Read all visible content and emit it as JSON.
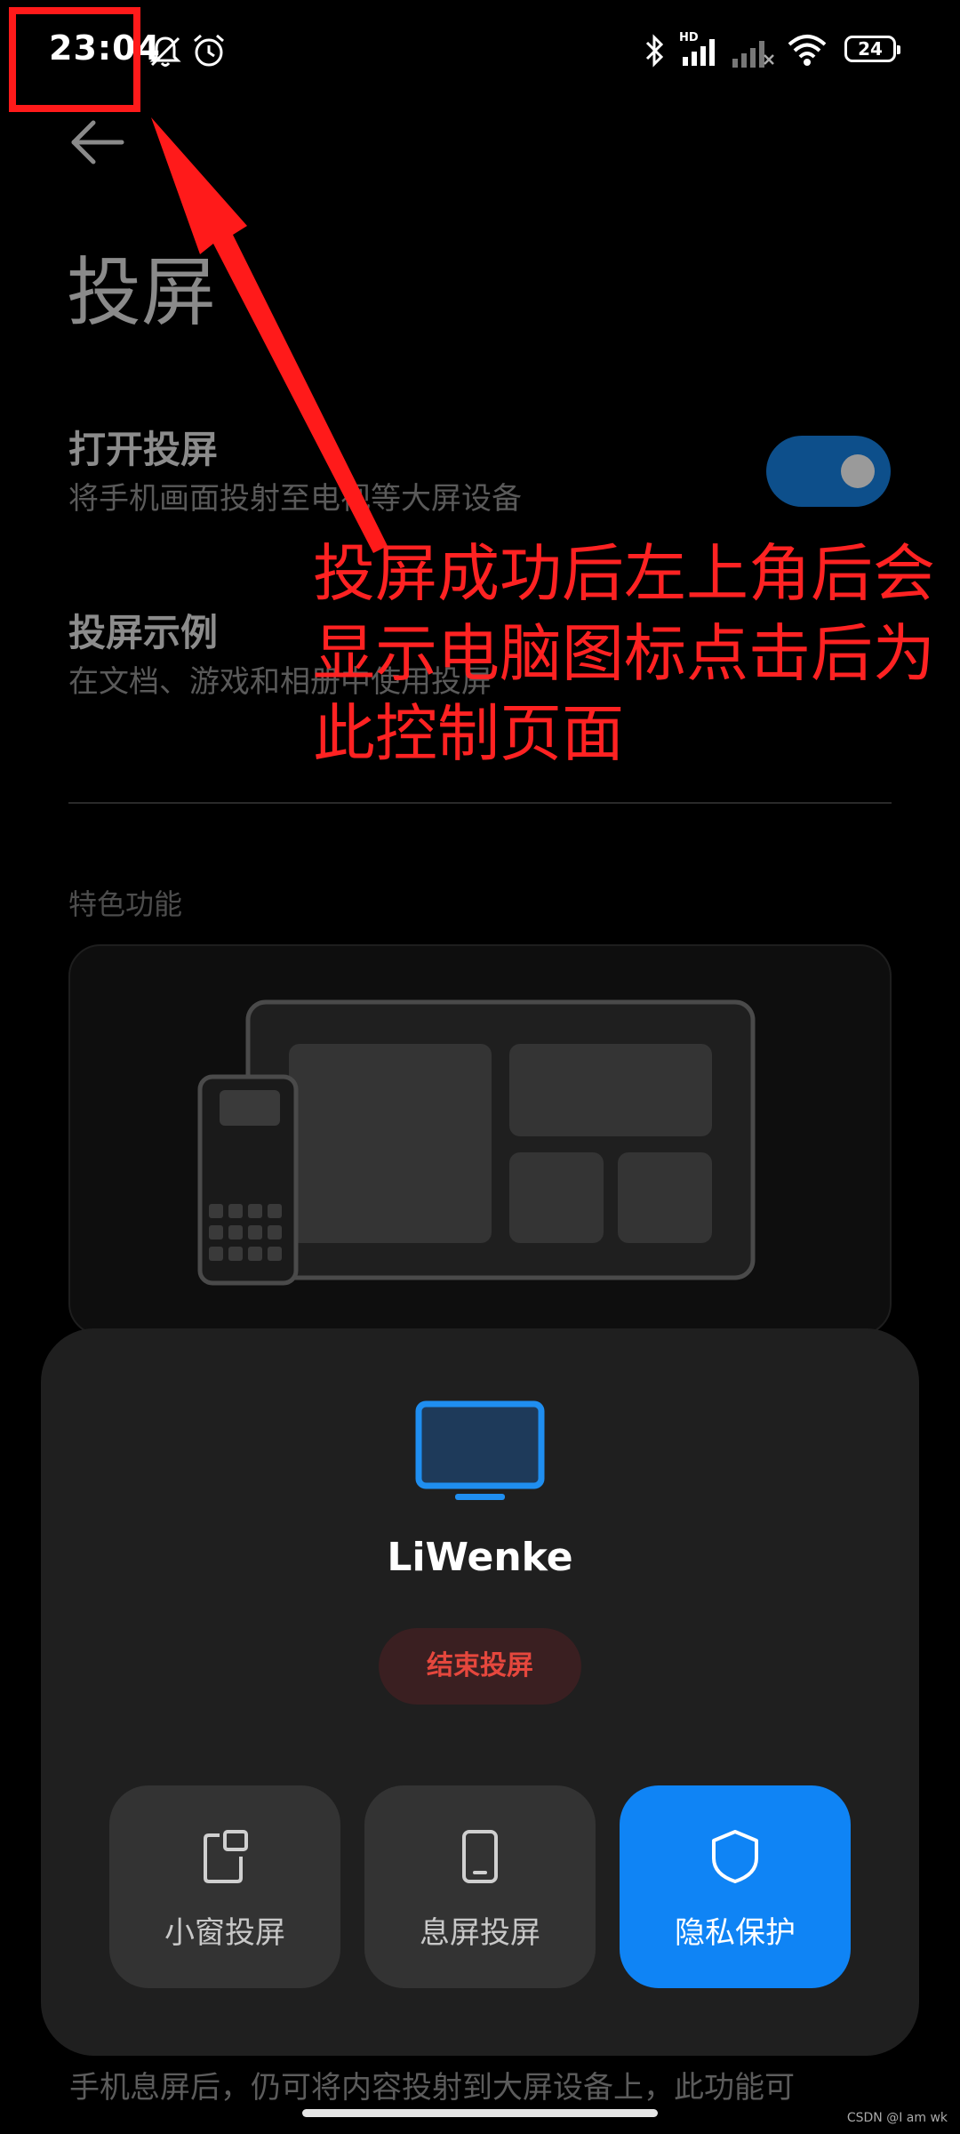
{
  "status_bar": {
    "time": "23:04",
    "battery_level": "24",
    "icons": [
      "mute-icon",
      "alarm-icon",
      "bluetooth-icon",
      "hd-signal-icon",
      "signal-icon",
      "wifi-icon",
      "battery-icon"
    ]
  },
  "page": {
    "title": "投屏",
    "back_icon": "arrow-left-icon"
  },
  "settings": [
    {
      "title": "打开投屏",
      "subtitle": "将手机画面投射至电视等大屏设备",
      "toggle_on": true
    },
    {
      "title": "投屏示例",
      "subtitle": "在文档、游戏和相册中使用投屏"
    }
  ],
  "section": {
    "header": "特色功能"
  },
  "bottom_text": "手机息屏后，仍可将内容投射到大屏设备上，此功能可",
  "cast_sheet": {
    "device_icon": "monitor-icon",
    "device_name": "LiWenke",
    "stop_label": "结束投屏",
    "actions": [
      {
        "label": "小窗投屏",
        "icon": "small-window-icon",
        "active": false
      },
      {
        "label": "息屏投屏",
        "icon": "phone-icon",
        "active": false
      },
      {
        "label": "隐私保护",
        "icon": "shield-icon",
        "active": true
      }
    ]
  },
  "annotation": {
    "text": "投屏成功后左上角后会显示电脑图标点击后为此控制页面"
  },
  "watermark": "CSDN @I am wk",
  "colors": {
    "accent": "#0f84f5",
    "toggle": "#0d4f8b",
    "stop": "#e5473d",
    "annotation": "#ff1a1a"
  }
}
